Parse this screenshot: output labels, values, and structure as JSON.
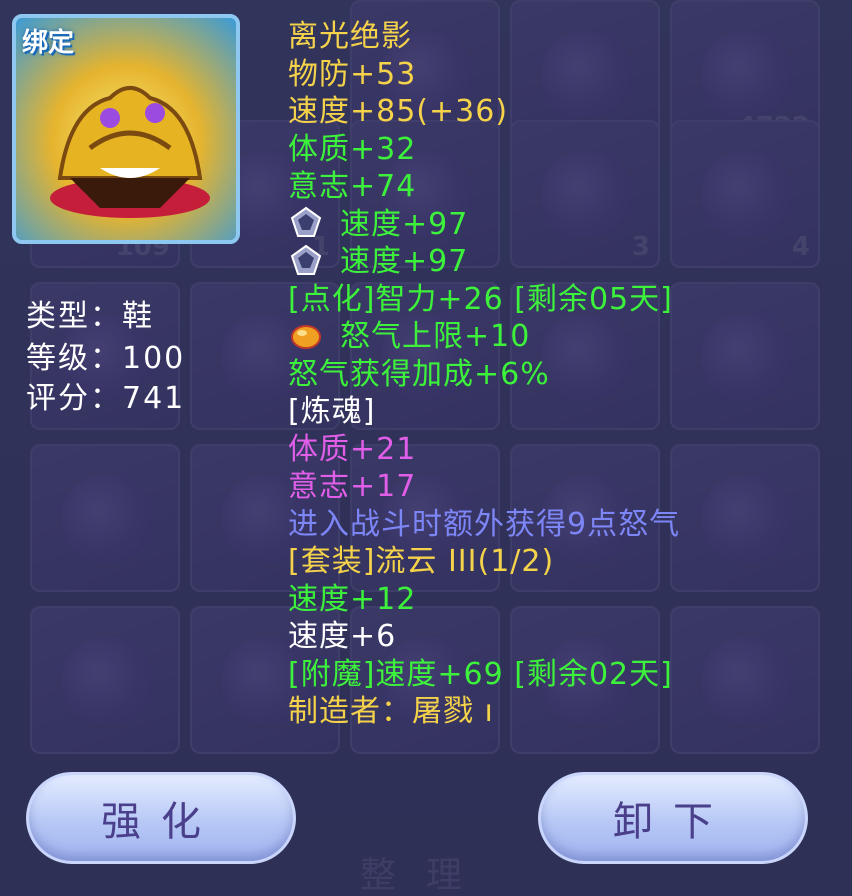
{
  "item": {
    "bind_tag": "绑定",
    "name": "离光绝影"
  },
  "meta": {
    "type": "类型：鞋",
    "level": "等级：100",
    "score": "评分：741"
  },
  "stats": [
    {
      "text": "物防+53",
      "color": "yellow"
    },
    {
      "text": "速度+85(+36)",
      "color": "yellow"
    },
    {
      "text": "体质+32",
      "color": "green"
    },
    {
      "text": "意志+74",
      "color": "green"
    },
    {
      "text": "速度+97",
      "color": "green",
      "icon": "gem-icon"
    },
    {
      "text": "速度+97",
      "color": "green",
      "icon": "gem-icon"
    },
    {
      "text": "[点化]智力+26 [剩余05天]",
      "color": "green"
    },
    {
      "text": "怒气上限+10",
      "color": "green",
      "icon": "amber-gem-icon"
    },
    {
      "text": "怒气获得加成+6%",
      "color": "green"
    },
    {
      "text": "[炼魂]",
      "color": "white"
    },
    {
      "text": "体质+21",
      "color": "pink"
    },
    {
      "text": "意志+17",
      "color": "pink"
    },
    {
      "text": "进入战斗时额外获得9点怒气",
      "color": "blue"
    },
    {
      "text": "[套装]流云 III(1/2)",
      "color": "yellow"
    },
    {
      "text": "速度+12",
      "color": "green"
    },
    {
      "text": "速度+6",
      "color": "white"
    },
    {
      "text": "[附魔]速度+69 [剩余02天]",
      "color": "green"
    },
    {
      "text": "制造者：屠戮 ı",
      "color": "yellow"
    }
  ],
  "buttons": {
    "enhance": "强化",
    "unequip": "卸下"
  },
  "background": {
    "slot_numbers": [
      "4722",
      "109",
      "1",
      "3",
      "4"
    ],
    "bottom_label": "整理"
  },
  "colors": {
    "yellow": "#f4d24a",
    "green": "#3cf23a",
    "white": "#ffffff",
    "pink": "#e05ee8",
    "blue": "#7d86f6"
  }
}
